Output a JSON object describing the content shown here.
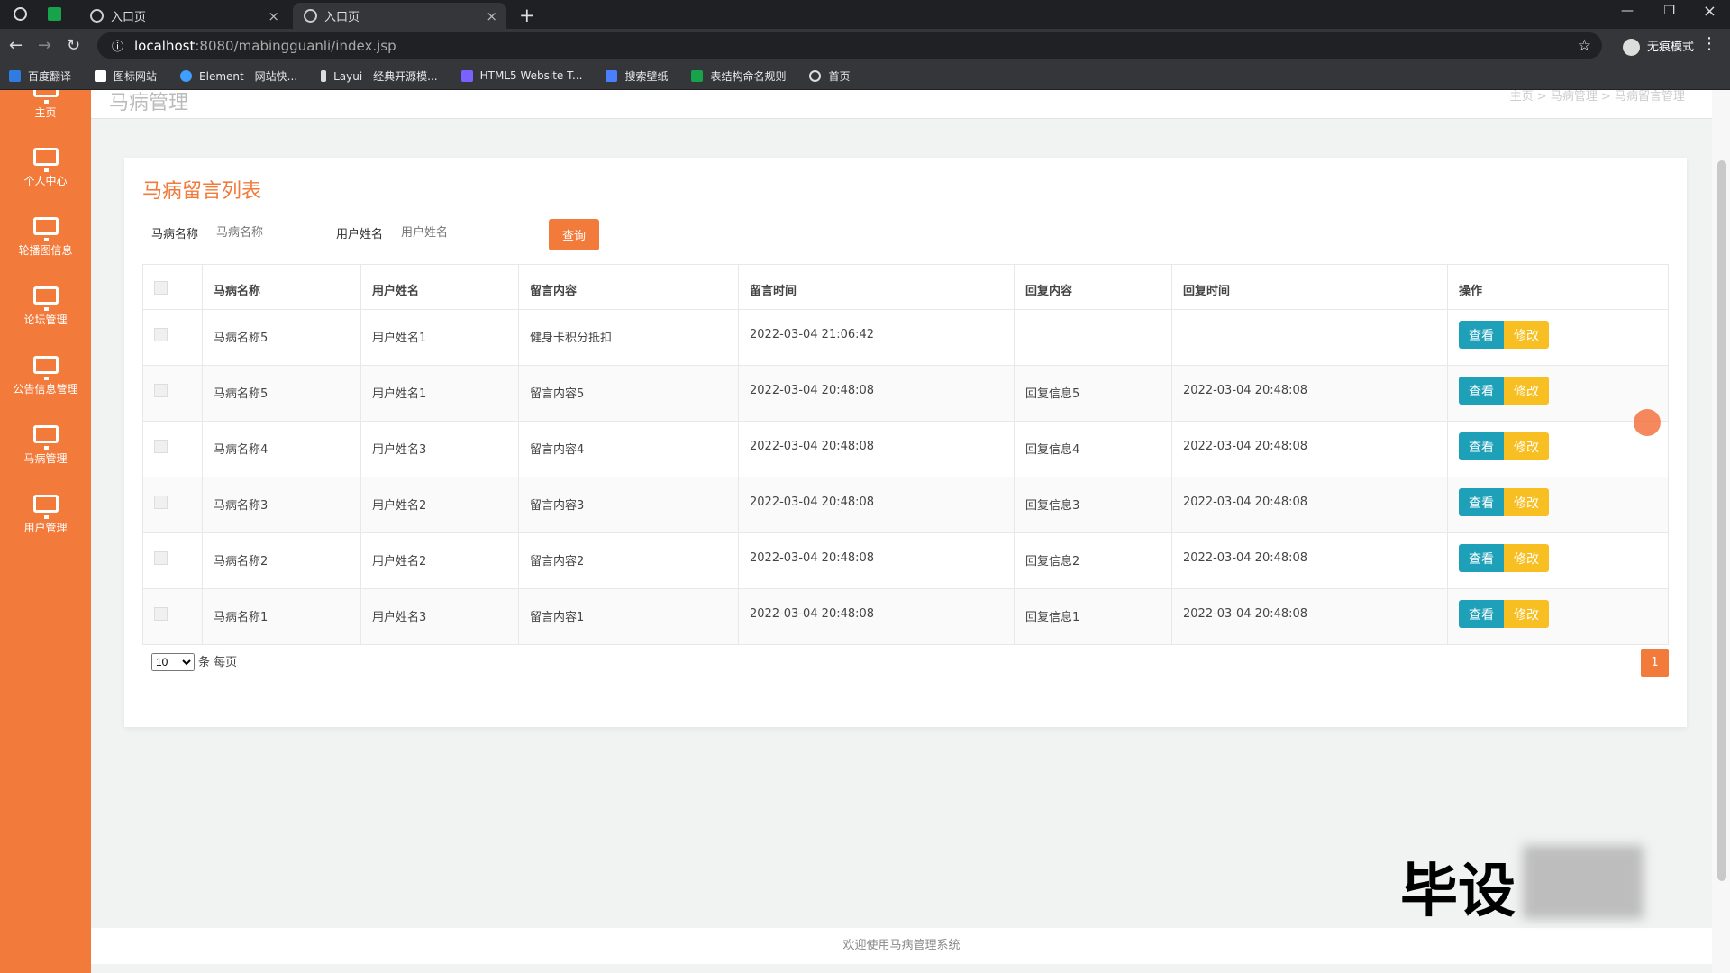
{
  "browser": {
    "tabs": [
      {
        "label": "入口页"
      },
      {
        "label": "入口页"
      }
    ],
    "url_host": "localhost",
    "url_path": ":8080/mabingguanli/index.jsp",
    "incognito": "无痕模式",
    "bookmarks": [
      "百度翻译",
      "图标网站",
      "Element - 网站快...",
      "Layui - 经典开源模...",
      "HTML5 Website T...",
      "搜索壁纸",
      "表结构命名规则",
      "首页"
    ]
  },
  "header": {
    "title": "马病管理",
    "breadcrumb": "主页 > 马病管理 > 马病留言管理"
  },
  "sidebar": {
    "items": [
      "主页",
      "个人中心",
      "轮播图信息",
      "论坛管理",
      "公告信息管理",
      "马病管理",
      "用户管理"
    ]
  },
  "panel": {
    "title": "马病留言列表",
    "filters": {
      "name_label": "马病名称",
      "name_placeholder": "马病名称",
      "user_label": "用户姓名",
      "user_placeholder": "用户姓名",
      "query": "查询"
    },
    "columns": [
      "马病名称",
      "用户姓名",
      "留言内容",
      "留言时间",
      "回复内容",
      "回复时间",
      "操作"
    ],
    "rows": [
      [
        "马病名称5",
        "用户姓名1",
        "健身卡积分抵扣",
        "2022-03-04 21:06:42",
        "",
        ""
      ],
      [
        "马病名称5",
        "用户姓名1",
        "留言内容5",
        "2022-03-04 20:48:08",
        "回复信息5",
        "2022-03-04 20:48:08"
      ],
      [
        "马病名称4",
        "用户姓名3",
        "留言内容4",
        "2022-03-04 20:48:08",
        "回复信息4",
        "2022-03-04 20:48:08"
      ],
      [
        "马病名称3",
        "用户姓名2",
        "留言内容3",
        "2022-03-04 20:48:08",
        "回复信息3",
        "2022-03-04 20:48:08"
      ],
      [
        "马病名称2",
        "用户姓名2",
        "留言内容2",
        "2022-03-04 20:48:08",
        "回复信息2",
        "2022-03-04 20:48:08"
      ],
      [
        "马病名称1",
        "用户姓名3",
        "留言内容1",
        "2022-03-04 20:48:08",
        "回复信息1",
        "2022-03-04 20:48:08"
      ]
    ],
    "actions": {
      "view": "查看",
      "edit": "修改"
    },
    "pagination": {
      "page_size": "10",
      "per_page": "条 每页",
      "current_page": "1"
    }
  },
  "footer": {
    "text": "欢迎使用马病管理系统"
  },
  "watermark": {
    "text": "毕设"
  }
}
